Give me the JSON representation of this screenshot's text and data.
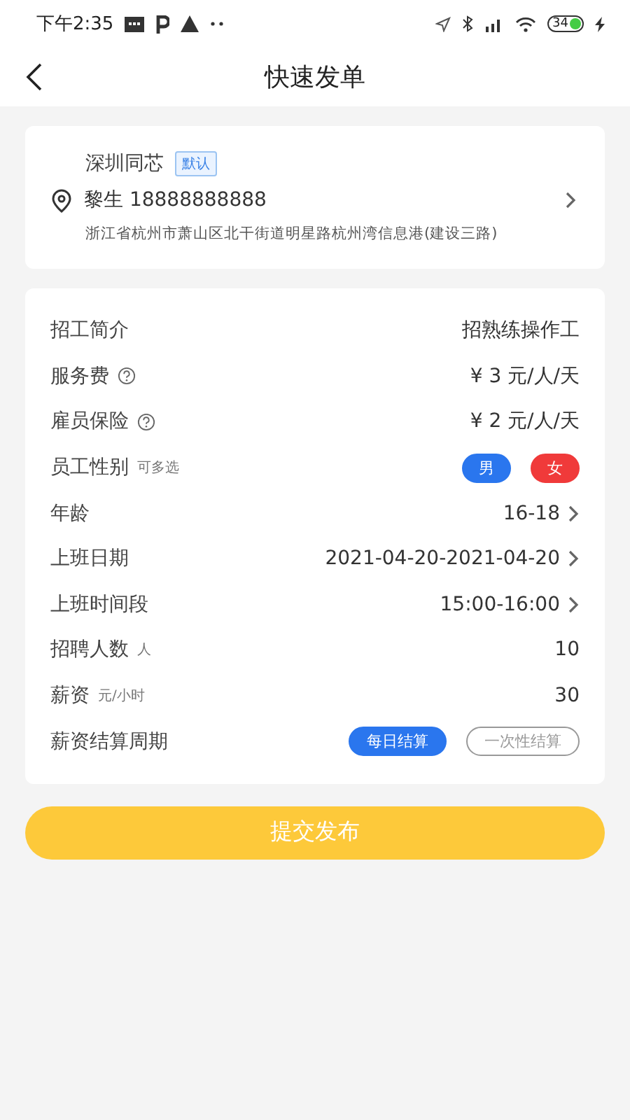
{
  "status_bar": {
    "time": "下午2:35",
    "battery": "34"
  },
  "header": {
    "title": "快速发单"
  },
  "address": {
    "company": "深圳同芯",
    "badge": "默认",
    "contact": "黎生 18888888888",
    "detail": "浙江省杭州市萧山区北干街道明星路杭州湾信息港(建设三路)"
  },
  "rows": [
    {
      "kind": "text",
      "label": "招工简介",
      "value": "招熟练操作工",
      "arrow": false,
      "help": false
    },
    {
      "kind": "text",
      "label": "服务费",
      "value": "¥ 3 元/人/天",
      "arrow": false,
      "help": true
    },
    {
      "kind": "text",
      "label": "雇员保险",
      "value": "¥ 2 元/人/天",
      "arrow": false,
      "help": true
    },
    {
      "kind": "chips",
      "label": "员工性别",
      "hint": "可多选",
      "chips": [
        {
          "label": "男",
          "selected": true,
          "color": "#2a76ee"
        },
        {
          "label": "女",
          "selected": true,
          "color": "#f03a3a"
        }
      ]
    },
    {
      "kind": "text",
      "label": "年龄",
      "value": "16-18",
      "arrow": true,
      "help": false
    },
    {
      "kind": "text",
      "label": "上班日期",
      "value": "2021-04-20-2021-04-20",
      "arrow": true,
      "help": false
    },
    {
      "kind": "text",
      "label": "上班时间段",
      "value": "15:00-16:00",
      "arrow": true,
      "help": false
    },
    {
      "kind": "text",
      "label": "招聘人数",
      "hint": "人",
      "value": "10",
      "arrow": false,
      "help": false
    },
    {
      "kind": "text",
      "label": "薪资",
      "hint": "元/小时",
      "value": "30",
      "arrow": false,
      "help": false
    },
    {
      "kind": "chips",
      "label": "薪资结算周期",
      "chips": [
        {
          "label": "每日结算",
          "selected": true
        },
        {
          "label": "一次性结算",
          "selected": false
        }
      ]
    }
  ],
  "submit": "提交发布"
}
